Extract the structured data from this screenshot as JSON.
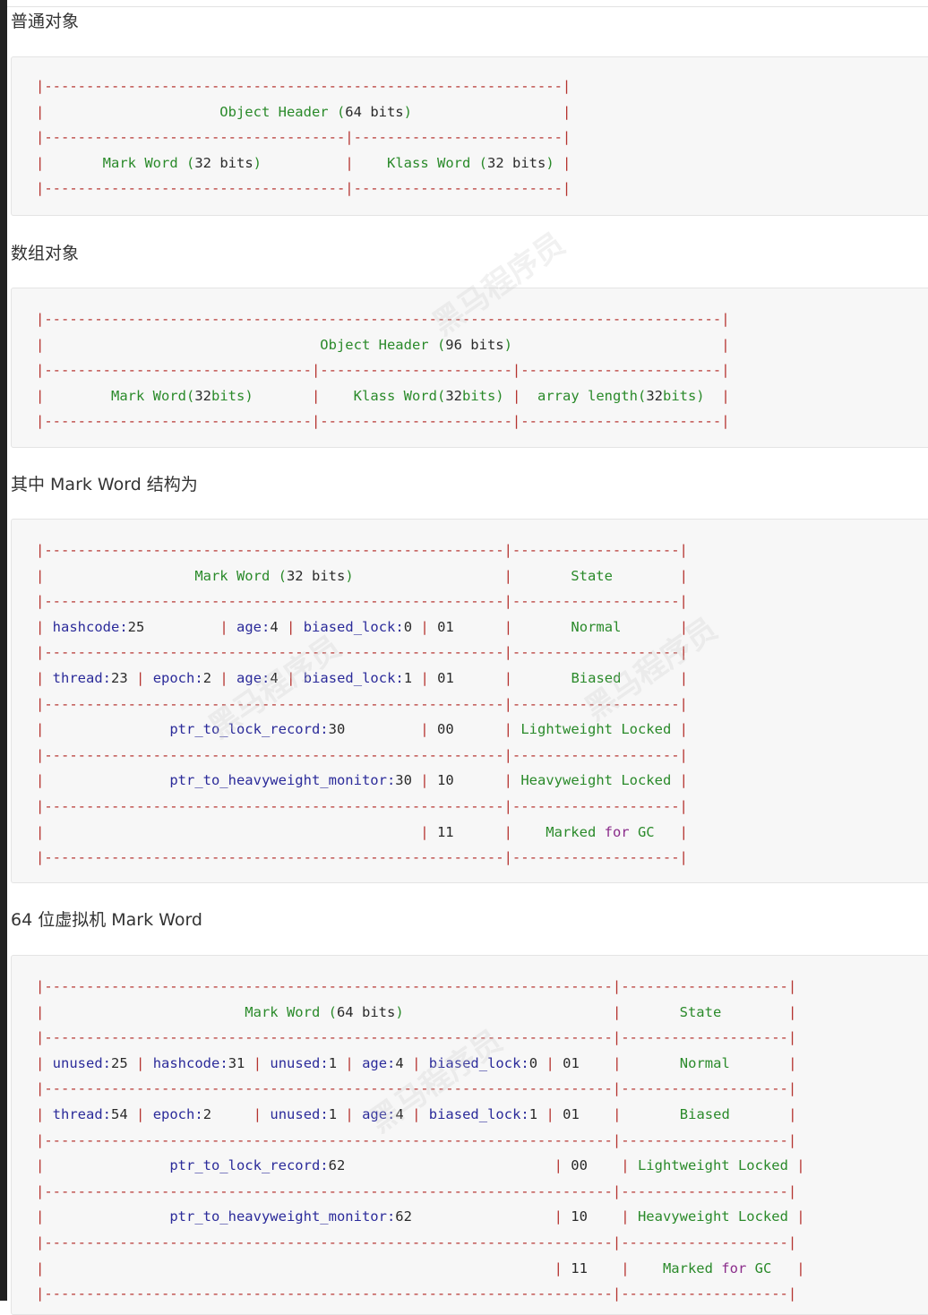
{
  "headings": {
    "h1": "普通对象",
    "h2": "数组对象",
    "h3": "其中 Mark Word 结构为",
    "h4": "64 位虚拟机 Mark Word"
  },
  "watermark": "黑马程序员",
  "colors": {
    "border": "#b5332f",
    "green_text": "#2a8a2a",
    "blue_text": "#2b2b9a",
    "bg_code": "#f7f7f7"
  },
  "blocks": {
    "normal_object": [
      "|--------------------------------------------------------------|",
      "|                     Object Header (64 bits)                  |",
      "|------------------------------------|-------------------------|",
      "|       Mark Word (32 bits)          |    Klass Word (32 bits) |",
      "|------------------------------------|-------------------------|"
    ],
    "array_object": [
      "|---------------------------------------------------------------------------------|",
      "|                                 Object Header (96 bits)                         |",
      "|--------------------------------|-----------------------|------------------------|",
      "|        Mark Word(32bits)       |    Klass Word(32bits) |  array length(32bits)  |",
      "|--------------------------------|-----------------------|------------------------|"
    ],
    "mark_word_32": [
      "|-------------------------------------------------------|--------------------|",
      "|                  Mark Word (32 bits)                  |       State        |",
      "|-------------------------------------------------------|--------------------|",
      "| hashcode:25         | age:4 | biased_lock:0 | 01      |       Normal       |",
      "|-------------------------------------------------------|--------------------|",
      "| thread:23 | epoch:2 | age:4 | biased_lock:1 | 01      |       Biased       |",
      "|-------------------------------------------------------|--------------------|",
      "|               ptr_to_lock_record:30         | 00      | Lightweight Locked |",
      "|-------------------------------------------------------|--------------------|",
      "|               ptr_to_heavyweight_monitor:30 | 10      | Heavyweight Locked |",
      "|-------------------------------------------------------|--------------------|",
      "|                                             | 11      |    Marked for GC   |",
      "|-------------------------------------------------------|--------------------|"
    ],
    "mark_word_64": [
      "|--------------------------------------------------------------------|--------------------|",
      "|                        Mark Word (64 bits)                         |       State        |",
      "|--------------------------------------------------------------------|--------------------|",
      "| unused:25 | hashcode:31 | unused:1 | age:4 | biased_lock:0 | 01    |       Normal       |",
      "|--------------------------------------------------------------------|--------------------|",
      "| thread:54 | epoch:2     | unused:1 | age:4 | biased_lock:1 | 01    |       Biased       |",
      "|--------------------------------------------------------------------|--------------------|",
      "|               ptr_to_lock_record:62                         | 00    | Lightweight Locked |",
      "|--------------------------------------------------------------------|--------------------|",
      "|               ptr_to_heavyweight_monitor:62                 | 10    | Heavyweight Locked |",
      "|--------------------------------------------------------------------|--------------------|",
      "|                                                             | 11    |    Marked for GC   |",
      "|--------------------------------------------------------------------|--------------------|"
    ]
  }
}
